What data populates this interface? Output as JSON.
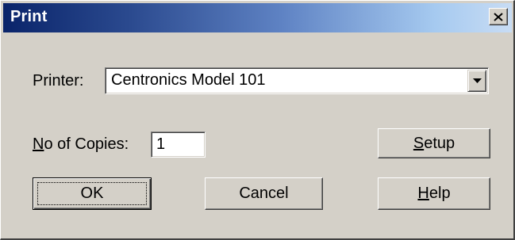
{
  "window": {
    "title": "Print",
    "close_icon": "close-icon"
  },
  "printer": {
    "label": "Printer:",
    "selected": "Centronics Model 101",
    "dropdown_icon": "chevron-down-icon"
  },
  "copies": {
    "label_mnemonic": "N",
    "label_rest": "o of Copies:",
    "value": "1"
  },
  "buttons": {
    "setup_mnemonic": "S",
    "setup_rest": "etup",
    "ok_label": "OK",
    "cancel_label": "Cancel",
    "help_mnemonic": "H",
    "help_rest": "elp"
  },
  "colors": {
    "face": "#d4d0c8",
    "title_start": "#0a246a",
    "title_end": "#a6caf0"
  }
}
